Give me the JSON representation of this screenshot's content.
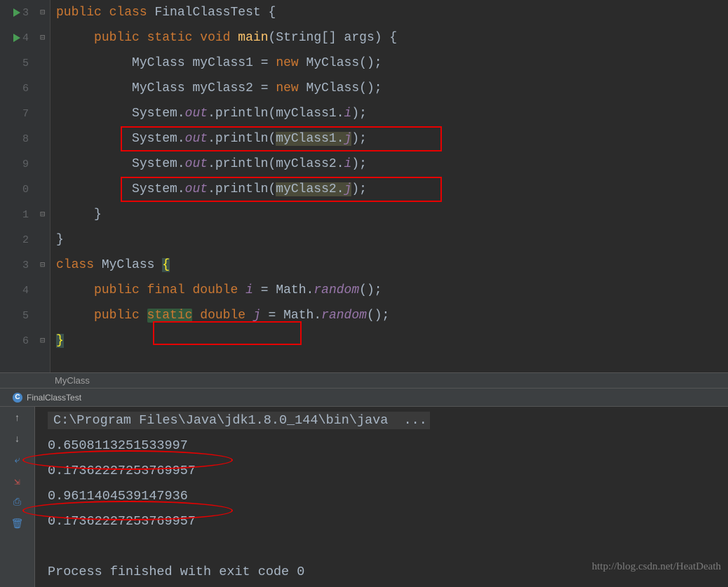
{
  "lineNumbers": [
    "3",
    "4",
    "5",
    "6",
    "7",
    "8",
    "9",
    "0",
    "1",
    "2",
    "3",
    "4",
    "5",
    "6"
  ],
  "code": {
    "l3": {
      "kw1": "public",
      "kw2": "class",
      "cls": "FinalClassTest",
      "ob": "{"
    },
    "l4": {
      "kw1": "public",
      "kw2": "static",
      "kw3": "void",
      "mth": "main",
      "sig": "(String[] args) {"
    },
    "l5": {
      "t": "MyClass",
      "v": "myClass1",
      "eq": "=",
      "kw": "new",
      "c": "MyClass();"
    },
    "l6": {
      "t": "MyClass",
      "v": "myClass2",
      "eq": "=",
      "kw": "new",
      "c": "MyClass();"
    },
    "l7": {
      "s": "System.",
      "o": "out",
      "p": ".println(myClass1.",
      "f": "i",
      "e": ");"
    },
    "l8": {
      "s": "System.",
      "o": "out",
      "p": ".println(",
      "arg": "myClass1.",
      "f": "j",
      "e": ");"
    },
    "l9": {
      "s": "System.",
      "o": "out",
      "p": ".println(myClass2.",
      "f": "i",
      "e": ");"
    },
    "l10": {
      "s": "System.",
      "o": "out",
      "p": ".println(",
      "arg": "myClass2.",
      "f": "j",
      "e": ");"
    },
    "l11": {
      "cb": "}"
    },
    "l12": {
      "cb": "}"
    },
    "l13": {
      "kw": "class",
      "cls": "MyClass",
      "ob": "{"
    },
    "l14": {
      "kw1": "public",
      "kw2": "final",
      "kw3": "double",
      "v": "i",
      "eq": "= Math.",
      "m": "random",
      "e": "();"
    },
    "l15": {
      "kw1": "public",
      "kw2": "static",
      "kw3": "double",
      "v": "j",
      "eq": "= Math.",
      "m": "random",
      "e": "();"
    },
    "l16": {
      "cb": "}"
    }
  },
  "breadcrumb": "MyClass",
  "tab": {
    "label": "FinalClassTest"
  },
  "console": {
    "cmd": "C:\\Program Files\\Java\\jdk1.8.0_144\\bin\\java  ...",
    "out1": "0.6508113251533997",
    "out2": "0.17362227253769957",
    "out3": "0.9611404539147936",
    "out4": "0.17362227253769957",
    "exit": "Process finished with exit code 0"
  },
  "watermark": "http://blog.csdn.net/HeatDeath"
}
